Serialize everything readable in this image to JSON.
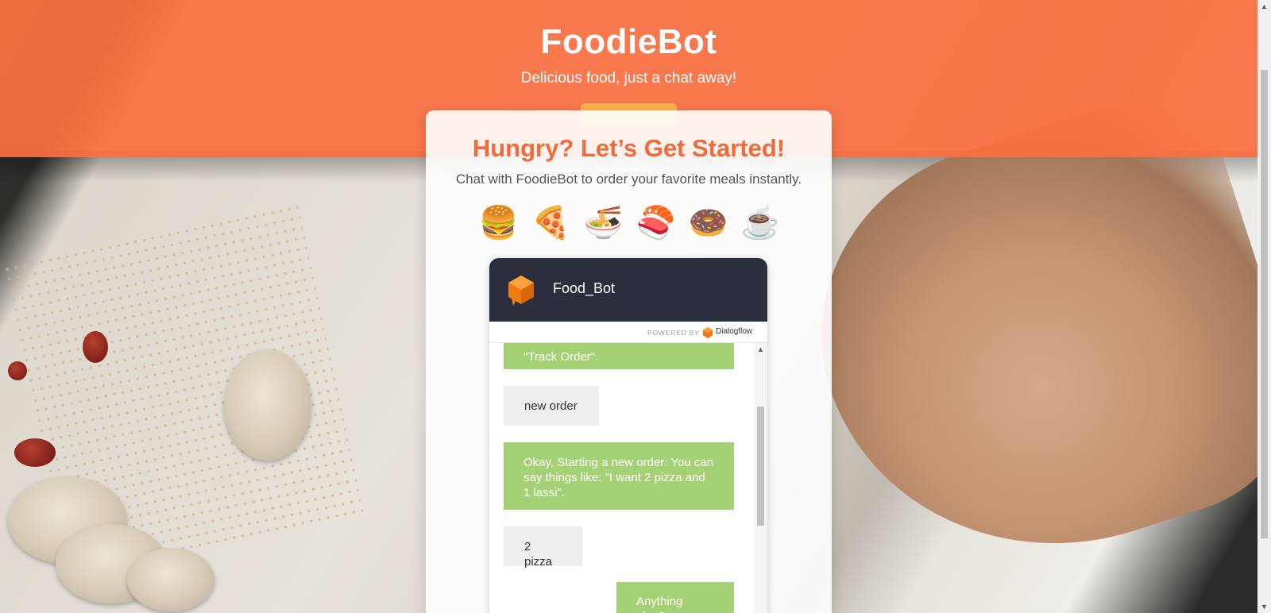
{
  "header": {
    "title": "FoodieBot",
    "subtitle": "Delicious food, just a chat away!"
  },
  "card": {
    "headline": "Hungry? Let’s Get Started!",
    "tagline": "Chat with FoodieBot to order your favorite meals instantly.",
    "emojis": [
      "🍔",
      "🍕",
      "🍜",
      "🍣",
      "🍩",
      "☕"
    ]
  },
  "chat": {
    "bot_name": "Food_Bot",
    "powered_by": "POWERED BY",
    "provider": "Dialogflow",
    "messages": [
      {
        "from": "bot",
        "text": "\"Track Order\"."
      },
      {
        "from": "user",
        "text": "new order"
      },
      {
        "from": "bot",
        "text": "Okay, Starting a new order: You can say things like: \"I want 2 pizza and 1 lassi\"."
      },
      {
        "from": "user",
        "text": "2 pizza"
      },
      {
        "from": "bot",
        "text": "Anything else?"
      }
    ]
  },
  "colors": {
    "header_bg": "#fa7042",
    "headline": "#f06a3b",
    "bot_bubble": "#a5d175",
    "user_bubble": "#eeeeee",
    "chat_header": "#2b2f3b"
  }
}
